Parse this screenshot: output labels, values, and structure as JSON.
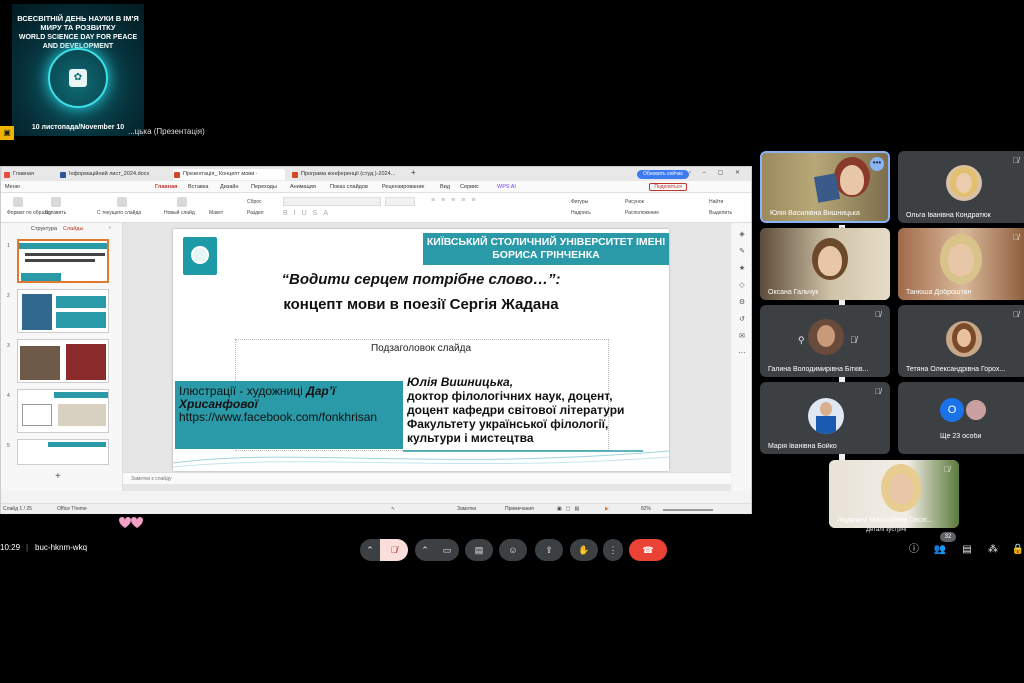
{
  "event_badge": {
    "title_ua": "ВСЕСВІТНІЙ ДЕНЬ НАУКИ В ІМ'Я МИРУ ТА РОЗВИТКУ",
    "title_en": "WORLD SCIENCE DAY FOR PEACE AND DEVELOPMENT",
    "date": "10 листопада/November 10"
  },
  "presenting": {
    "title": "...цька (Презентація)"
  },
  "browser": {
    "tabs": [
      {
        "label": "Главная",
        "color": "#e74c3c"
      },
      {
        "label": "Інформаційний лист_2024.docx",
        "color": "#2b5797"
      },
      {
        "label": "Презентація_ Концепт мови ·",
        "color": "#d24726"
      },
      {
        "label": "Програма конференції (студ.)-2024...",
        "color": "#d24726"
      }
    ],
    "update_label": "Обновить сейчас"
  },
  "menu": {
    "items": [
      "Меню",
      "Главная",
      "Вставка",
      "Дизайн",
      "Переходы",
      "Анимация",
      "Показ слайдов",
      "Рецензирование",
      "Вид",
      "Сервис",
      "WPS AI"
    ],
    "active": "Главная",
    "share_label": "Поделиться"
  },
  "ribbon": {
    "format_painter": "Формат по образцу",
    "paste": "Вставить",
    "from_current": "С текущего слайда",
    "new_slide": "Новый слайд",
    "layout": "Макет",
    "reset": "Сброс",
    "section": "Раздел",
    "figures": "Фигуры",
    "picture": "Рисунок",
    "caption": "Надпись",
    "arrange": "Расположение",
    "find": "Найти",
    "select": "Выделить"
  },
  "panel": {
    "structure": "Структура",
    "slides": "Слайды",
    "slide_numbers": [
      "1",
      "2",
      "3",
      "4",
      "5"
    ]
  },
  "slide": {
    "university": "КИЇВСЬКИЙ СТОЛИЧНИЙ УНІВЕРСИТЕТ ІМЕНІ БОРИСА ГРІНЧЕНКА",
    "title": "“Водити серцем потрібне слово…”:",
    "subtitle": "концепт мови в поезії Сергія Жадана",
    "placeholder": "Подзаголовок слайда",
    "illustrations_prefix": "Ілюстрації - художниці ",
    "illustrations_artist": "Дар’ї Хрисанфової",
    "illustrations_link": "https://www.facebook.com/fonkhrisan",
    "author_name": "Юлія Вишницька,",
    "author_line1": "доктор філологічних наук, доцент,",
    "author_line2": "доцент кафедри світової літератури",
    "author_line3": "Факультету української філології,",
    "author_line4": "культури і мистецтва"
  },
  "notes_placeholder": "Заметки к слайду",
  "status": {
    "slide_count": "Слайд 1 / 25",
    "theme": "Office Theme",
    "notes_btn": "Заметки",
    "comments_btn": "Примечания",
    "zoom": "82%"
  },
  "participants": [
    {
      "name": "Юлія Василівна Вишницька",
      "muted": false,
      "video": true
    },
    {
      "name": "Ольга Іванівна Кондратюк",
      "muted": true,
      "video": false
    },
    {
      "name": "Оксана Гальчук",
      "muted": false,
      "video": true
    },
    {
      "name": "Танюша Доброштан",
      "muted": true,
      "video": true
    },
    {
      "name": "Галина Володимирівна Бітків...",
      "muted": true,
      "video": false
    },
    {
      "name": "Тетяна Олександрівна Горох...",
      "muted": true,
      "video": false
    },
    {
      "name": "Марія Іванівна Бойко",
      "muted": true,
      "video": false
    },
    {
      "name": "Ще 23 особи",
      "muted": false,
      "video": false
    },
    {
      "name": "Людмила Миколаївна Овсіє...",
      "muted": true,
      "video": true
    }
  ],
  "more_initial": "О",
  "meeting": {
    "time": "10:29",
    "code": "buc-hknm-wkq",
    "details": "Деталі зустрічі",
    "participant_count": "32"
  },
  "colors": {
    "teal_accent": "#2a9aa8",
    "end_call": "#ea4335",
    "meet_bg": "#000000"
  }
}
